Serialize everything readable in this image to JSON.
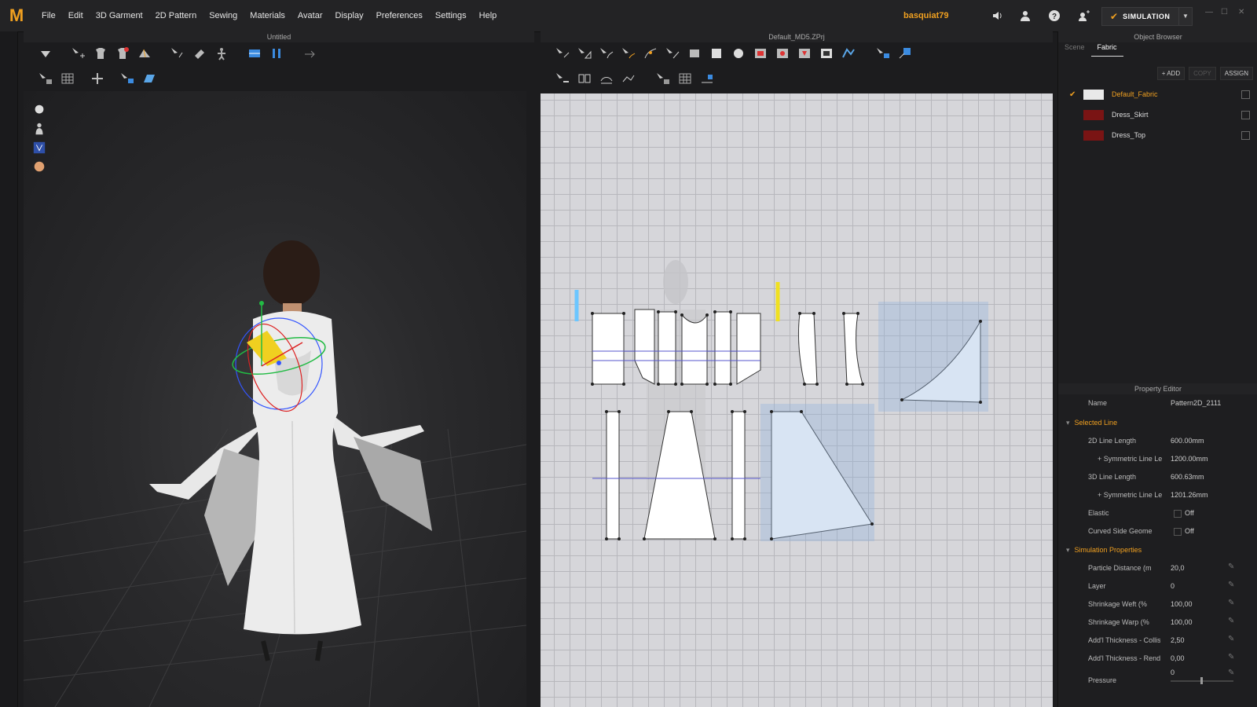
{
  "app": {
    "logo": "M"
  },
  "menu": [
    "File",
    "Edit",
    "3D Garment",
    "2D Pattern",
    "Sewing",
    "Materials",
    "Avatar",
    "Display",
    "Preferences",
    "Settings",
    "Help"
  ],
  "user": {
    "name": "basquiat79"
  },
  "simulation": {
    "label": "SIMULATION"
  },
  "panels": {
    "left_title": "Untitled",
    "mid_title": "Default_MD5.ZPrj",
    "right_title": "Object Browser"
  },
  "object_browser": {
    "tabs": [
      "Scene",
      "Fabric"
    ],
    "buttons": [
      "+ ADD",
      "COPY",
      "ASSIGN"
    ],
    "fabrics": [
      {
        "name": "Default_Fabric",
        "color": "#e9e9e9",
        "checked": true
      },
      {
        "name": "Dress_Skirt",
        "color": "#7a1414",
        "checked": false
      },
      {
        "name": "Dress_Top",
        "color": "#7a1414",
        "checked": false
      }
    ]
  },
  "property_editor": {
    "title": "Property Editor",
    "name_label": "Name",
    "name_value": "Pattern2D_2111",
    "selected_line": {
      "title": "Selected Line",
      "rows": [
        {
          "label": "2D Line Length",
          "value": "600.00mm"
        },
        {
          "label": "+ Symmetric Line Le",
          "value": "1200.00mm"
        },
        {
          "label": "3D Line Length",
          "value": "600.63mm"
        },
        {
          "label": "+ Symmetric Line Le",
          "value": "1201.26mm"
        },
        {
          "label": "Elastic",
          "value": "Off"
        },
        {
          "label": "Curved Side Geome",
          "value": "Off"
        }
      ]
    },
    "simulation_properties": {
      "title": "Simulation Properties",
      "rows": [
        {
          "label": "Particle Distance (m",
          "value": "20,0"
        },
        {
          "label": "Layer",
          "value": "0"
        },
        {
          "label": "Shrinkage Weft (%",
          "value": "100,00"
        },
        {
          "label": "Shrinkage Warp (%",
          "value": "100,00"
        },
        {
          "label": "Add'l Thickness - Collisio",
          "value": "2,50"
        },
        {
          "label": "Add'l Thickness - Renderi",
          "value": "0,00"
        },
        {
          "label": "Pressure",
          "value": "0"
        }
      ]
    }
  }
}
